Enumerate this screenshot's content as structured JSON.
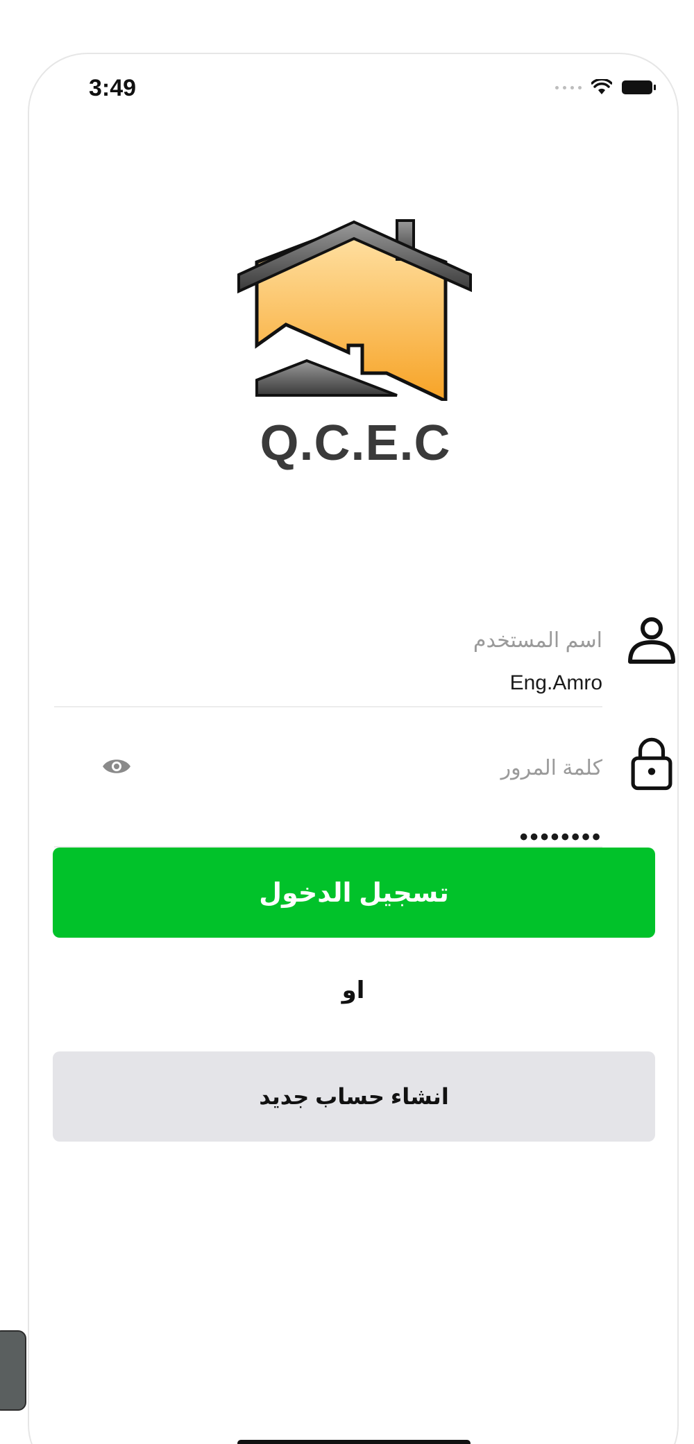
{
  "status_bar": {
    "time": "3:49"
  },
  "logo": {
    "text": "Q.C.E.C"
  },
  "form": {
    "username": {
      "label": "اسم المستخدم",
      "value": "Eng.Amro",
      "icon": "user-icon"
    },
    "password": {
      "label": "كلمة المرور",
      "value": "••••••••",
      "icon": "lock-icon",
      "toggle_icon": "eye-icon"
    }
  },
  "buttons": {
    "login_label": "تسجيل الدخول",
    "or_label": "او",
    "register_label": "انشاء حساب جديد"
  },
  "colors": {
    "login_button": "#01c22a",
    "register_button": "#e4e4e8",
    "logo_orange": "#fbb03b",
    "logo_gray": "#4a4a4a"
  }
}
